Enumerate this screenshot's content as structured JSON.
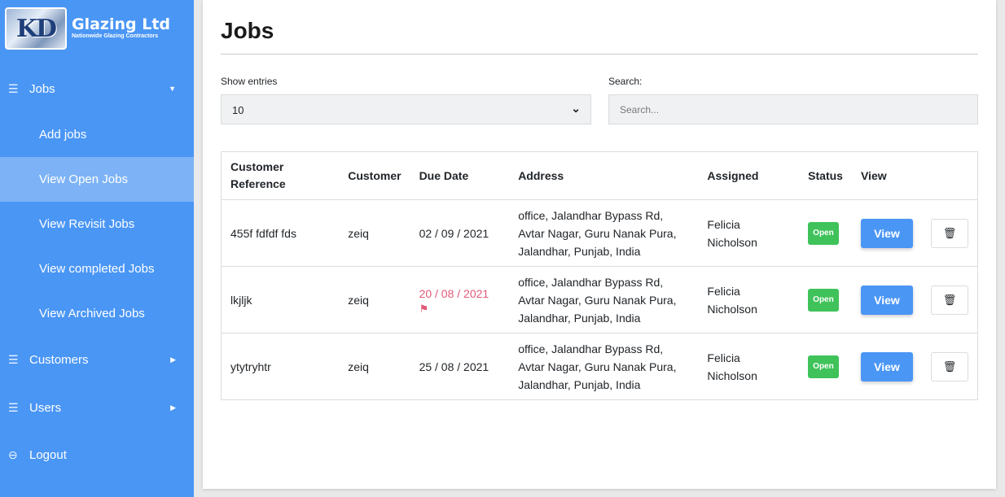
{
  "brand": {
    "logo_text": "KD",
    "name": "Glazing Ltd",
    "tagline": "Nationwide Glazing Contractors"
  },
  "sidebar": {
    "jobs": "Jobs",
    "sub": [
      "Add jobs",
      "View Open Jobs",
      "View Revisit Jobs",
      "View completed Jobs",
      "View Archived Jobs"
    ],
    "customers": "Customers",
    "users": "Users",
    "logout": "Logout"
  },
  "page": {
    "title": "Jobs"
  },
  "controls": {
    "show_entries_label": "Show entries",
    "entries_value": "10",
    "search_label": "Search:",
    "search_placeholder": "Search..."
  },
  "table": {
    "headers": [
      "Customer Reference",
      "Customer",
      "Due Date",
      "Address",
      "Assigned",
      "Status",
      "View"
    ],
    "rows": [
      {
        "ref": "455f fdfdf fds",
        "customer": "zeiq",
        "due": "02 / 09 / 2021",
        "address": "office, Jalandhar Bypass Rd, Avtar Nagar, Guru Nanak Pura, Jalandhar, Punjab, India",
        "assigned": "Felicia Nicholson",
        "status": "Open",
        "view": "View"
      },
      {
        "ref": "lkjljk",
        "customer": "zeiq",
        "due": "20 / 08 / 2021",
        "address": "office, Jalandhar Bypass Rd, Avtar Nagar, Guru Nanak Pura, Jalandhar, Punjab, India",
        "assigned": "Felicia Nicholson",
        "status": "Open",
        "view": "View"
      },
      {
        "ref": "ytytryhtr",
        "customer": "zeiq",
        "due": "25 / 08 / 2021",
        "address": "office, Jalandhar Bypass Rd, Avtar Nagar, Guru Nanak Pura, Jalandhar, Punjab, India",
        "assigned": "Felicia Nicholson",
        "status": "Open",
        "view": "View"
      }
    ]
  },
  "icons": {
    "menu": "menu-icon",
    "caret_down": "caret-down-icon",
    "caret_right": "caret-right-icon",
    "logout": "logout-icon",
    "flag": "flag-icon",
    "trash": "trash-icon",
    "chevron": "chevron-down-icon"
  },
  "colors": {
    "sidebar": "#4a96f5",
    "active": "#7db3f6",
    "badge": "#3fc25a",
    "overdue": "#e05a78"
  }
}
